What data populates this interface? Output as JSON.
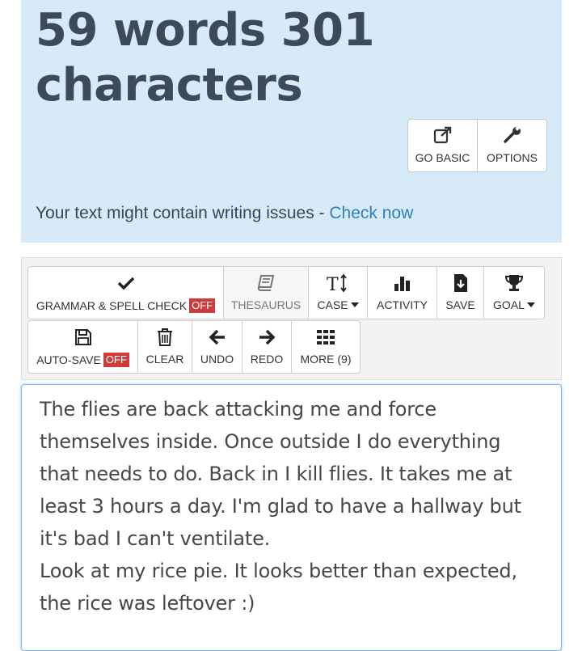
{
  "stats": {
    "title": "59 words 301 characters",
    "buttons": {
      "go_basic": "GO BASIC",
      "options": "OPTIONS"
    },
    "issues_text": "Your text might contain writing issues - ",
    "issues_link": "Check now"
  },
  "toolbar": {
    "grammar_label": "GRAMMAR & SPELL CHECK",
    "grammar_state": "OFF",
    "thesaurus_label": "THESAURUS",
    "case_label": "CASE",
    "activity_label": "ACTIVITY",
    "save_label": "SAVE",
    "goal_label": "GOAL",
    "autosave_label": "AUTO-SAVE",
    "autosave_state": "OFF",
    "clear_label": "CLEAR",
    "undo_label": "UNDO",
    "redo_label": "REDO",
    "more_label": "MORE (9)"
  },
  "editor": {
    "text": "The flies are back attacking me and force themselves inside. Once outside I do everything that needs to do. Back in I kill flies. It takes me at least 3 hours a day. I'm glad to have a hallway but it's bad I can't ventilate.\nLook at my rice pie. It looks better than expected, the rice was leftover :)"
  },
  "colors": {
    "panel_bg": "#d6eaf7",
    "link": "#2f7fc1",
    "badge_off": "#cf3a3a"
  }
}
